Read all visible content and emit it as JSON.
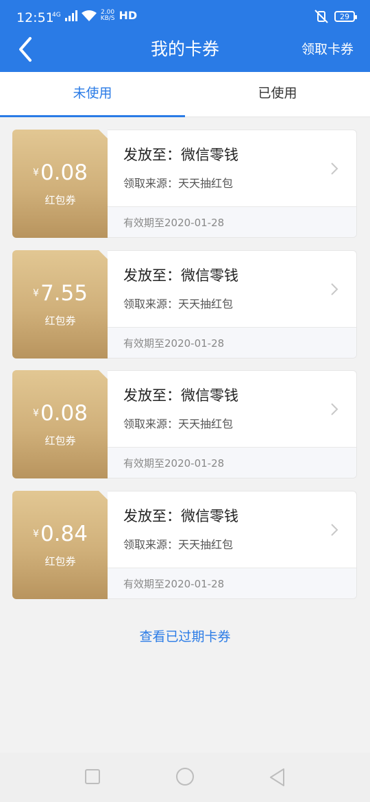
{
  "status_bar": {
    "time": "12:51",
    "network": "4G",
    "speed_value": "2.00",
    "speed_unit": "KB/S",
    "hd": "HD",
    "battery": "29"
  },
  "header": {
    "title": "我的卡券",
    "action": "领取卡券",
    "background_color": "#2a7be6"
  },
  "tabs": [
    {
      "label": "未使用",
      "active": true
    },
    {
      "label": "已使用",
      "active": false
    }
  ],
  "coupons": [
    {
      "currency": "¥",
      "amount": "0.08",
      "type": "红包券",
      "title": "发放至：微信零钱",
      "source": "领取来源：天天抽红包",
      "expiry": "有效期至2020-01-28"
    },
    {
      "currency": "¥",
      "amount": "7.55",
      "type": "红包券",
      "title": "发放至：微信零钱",
      "source": "领取来源：天天抽红包",
      "expiry": "有效期至2020-01-28"
    },
    {
      "currency": "¥",
      "amount": "0.08",
      "type": "红包券",
      "title": "发放至：微信零钱",
      "source": "领取来源：天天抽红包",
      "expiry": "有效期至2020-01-28"
    },
    {
      "currency": "¥",
      "amount": "0.84",
      "type": "红包券",
      "title": "发放至：微信零钱",
      "source": "领取来源：天天抽红包",
      "expiry": "有效期至2020-01-28"
    }
  ],
  "expired_link": "查看已过期卡券",
  "icons": {
    "back": "back-arrow-icon",
    "chevron": "chevron-right-icon",
    "nav_recent": "square-icon",
    "nav_home": "circle-icon",
    "nav_back": "triangle-back-icon"
  }
}
